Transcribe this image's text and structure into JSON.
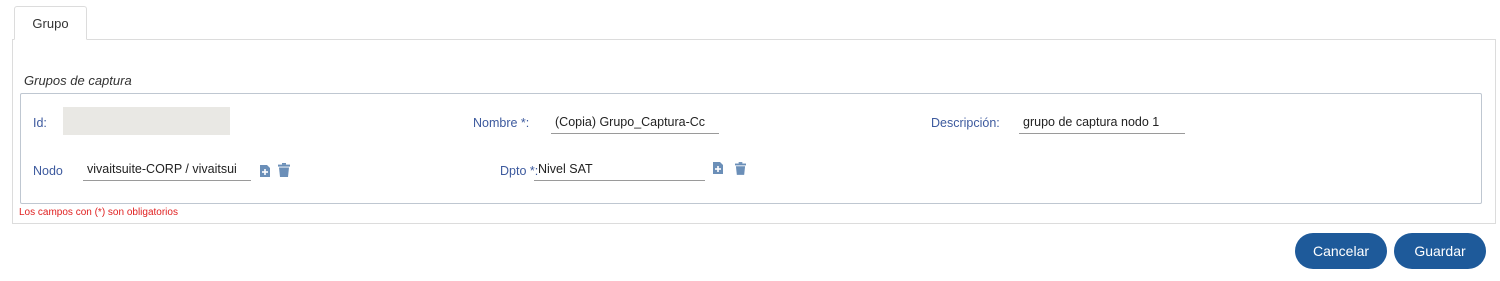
{
  "tabs": [
    {
      "label": "Grupo"
    }
  ],
  "section": {
    "title": "Grupos de captura"
  },
  "form": {
    "id": {
      "label": "Id:",
      "value": ""
    },
    "nombre": {
      "label": "Nombre *:",
      "value": "(Copia) Grupo_Captura-Cc"
    },
    "descripcion": {
      "label": "Descripción:",
      "value": "grupo de captura nodo 1"
    },
    "nodo": {
      "label": "Nodo",
      "value": "vivaitsuite-CORP / vivaitsui"
    },
    "dpto": {
      "label": "Dpto *:",
      "value": "Nivel SAT"
    }
  },
  "footnote": "Los campos con (*) son obligatorios",
  "actions": {
    "cancel_label": "Cancelar",
    "save_label": "Guardar"
  },
  "colors": {
    "primary": "#1e5a9a",
    "label": "#3d5a9e",
    "required_note": "#e02020",
    "icon": "#6b8fb8"
  },
  "icons": [
    "add-document-icon",
    "trash-icon"
  ]
}
